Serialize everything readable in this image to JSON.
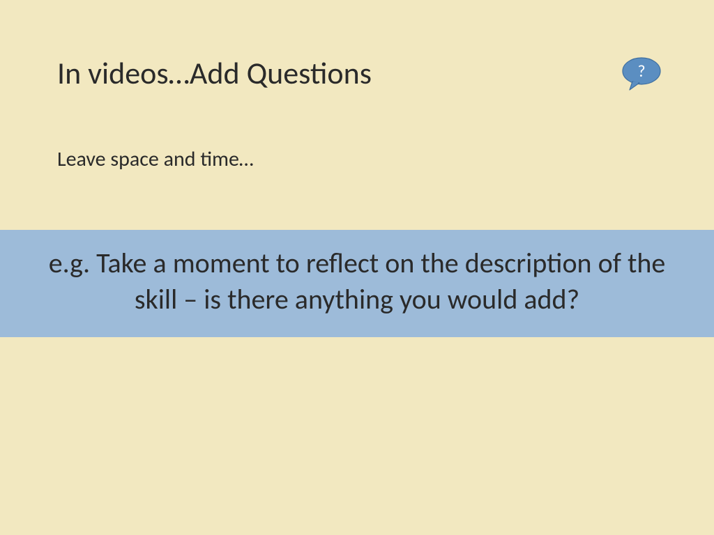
{
  "slide": {
    "title": "In videos…Add Questions",
    "subtitle": "Leave space and time…",
    "callout": "e.g. Take a moment to reflect on the description of the skill – is there anything you would add?",
    "bubble_symbol": "?"
  },
  "colors": {
    "background": "#f2e8c0",
    "band": "#9dbbd9",
    "bubble": "#5b8ec1"
  }
}
